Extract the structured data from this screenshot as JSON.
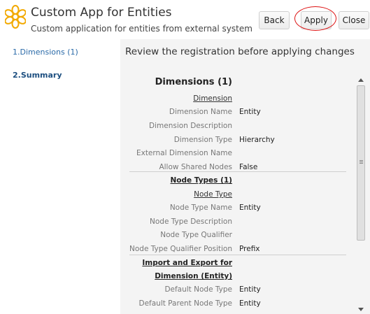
{
  "header": {
    "title": "Custom App for Entities",
    "subtitle": "Custom application for entities from external system",
    "icon": "flower-icon",
    "accent_color": "#f2a900"
  },
  "buttons": {
    "back": "Back",
    "apply": "Apply",
    "close": "Close"
  },
  "sidebar": {
    "items": [
      {
        "label": "1.Dimensions (1)",
        "active": false
      },
      {
        "label": "2.Summary",
        "active": true
      }
    ]
  },
  "main": {
    "heading": "Review the registration before applying changes",
    "rows": [
      {
        "label": "Dimensions (1)",
        "value": "",
        "style": "section"
      },
      {
        "label": "Dimension",
        "value": "",
        "style": "subsection"
      },
      {
        "label": "Dimension Name",
        "value": "Entity",
        "style": "field"
      },
      {
        "label": "Dimension Description",
        "value": "",
        "style": "field"
      },
      {
        "label": "Dimension Type",
        "value": "Hierarchy",
        "style": "field"
      },
      {
        "label": "External Dimension Name",
        "value": "",
        "style": "field"
      },
      {
        "label": "Allow Shared Nodes",
        "value": "False",
        "style": "field"
      },
      {
        "label": "Node Types (1)",
        "value": "",
        "style": "bold-subsection"
      },
      {
        "label": "Node Type",
        "value": "",
        "style": "subsection"
      },
      {
        "label": "Node Type Name",
        "value": "Entity",
        "style": "field"
      },
      {
        "label": "Node Type Description",
        "value": "",
        "style": "field"
      },
      {
        "label": "Node Type Qualifier",
        "value": "",
        "style": "field"
      },
      {
        "label": "Node Type Qualifier Position",
        "value": "Prefix",
        "style": "field"
      },
      {
        "label": "Import and Export for",
        "value": "",
        "style": "bold-subsection"
      },
      {
        "label": "Dimension (Entity)",
        "value": "",
        "style": "bold-subsection"
      },
      {
        "label": "Default Node Type",
        "value": "Entity",
        "style": "field"
      },
      {
        "label": "Default Parent Node Type",
        "value": "Entity",
        "style": "field"
      }
    ]
  }
}
